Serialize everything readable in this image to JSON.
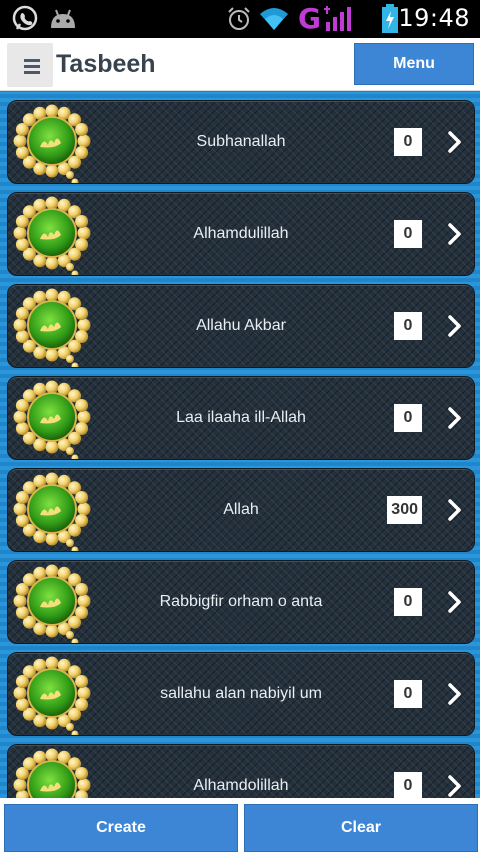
{
  "status_bar": {
    "time": "19:48",
    "network_label": "G",
    "icons": [
      "viber-icon",
      "android-icon",
      "alarm-icon",
      "wifi-icon",
      "signal-icon",
      "battery-icon"
    ]
  },
  "app_bar": {
    "title": "Tasbeeh",
    "menu_label": "Menu",
    "drawer_icon": "hamburger-icon"
  },
  "items": [
    {
      "label": "Subhanallah",
      "count": "0"
    },
    {
      "label": "Alhamdulillah",
      "count": "0"
    },
    {
      "label": "Allahu Akbar",
      "count": "0"
    },
    {
      "label": "Laa ilaaha ill-Allah",
      "count": "0"
    },
    {
      "label": "Allah",
      "count": "300"
    },
    {
      "label": "Rabbigfir orham o anta",
      "count": "0"
    },
    {
      "label": "sallahu alan nabiyil um",
      "count": "0"
    },
    {
      "label": "Alhamdolillah",
      "count": "0"
    }
  ],
  "bottom_bar": {
    "create_label": "Create",
    "clear_label": "Clear"
  },
  "colors": {
    "accent": "#3d86d6",
    "list_background": "#1e88cf",
    "row_background": "#24303b"
  }
}
